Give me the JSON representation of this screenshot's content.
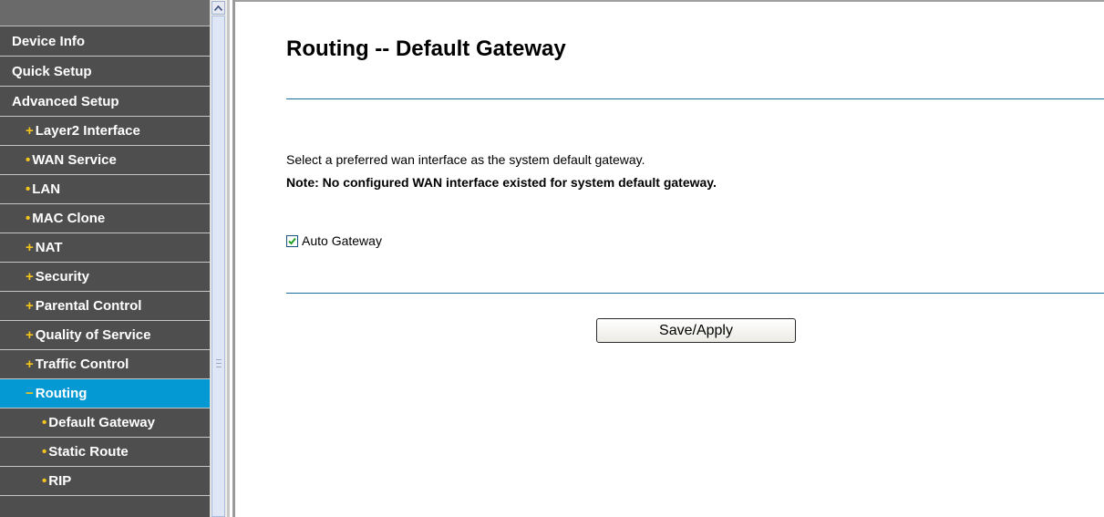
{
  "sidebar": {
    "items": [
      {
        "label": "Device Info",
        "bullet": ""
      },
      {
        "label": "Quick Setup",
        "bullet": ""
      },
      {
        "label": "Advanced Setup",
        "bullet": ""
      },
      {
        "label": "Layer2 Interface",
        "bullet": "+"
      },
      {
        "label": "WAN Service",
        "bullet": "•"
      },
      {
        "label": "LAN",
        "bullet": "•"
      },
      {
        "label": "MAC Clone",
        "bullet": "•"
      },
      {
        "label": "NAT",
        "bullet": "+"
      },
      {
        "label": "Security",
        "bullet": "+"
      },
      {
        "label": "Parental Control",
        "bullet": "+"
      },
      {
        "label": "Quality of Service",
        "bullet": "+"
      },
      {
        "label": "Traffic Control",
        "bullet": "+"
      },
      {
        "label": "Routing",
        "bullet": "−",
        "active": true
      },
      {
        "label": "Default Gateway",
        "bullet": "•"
      },
      {
        "label": "Static Route",
        "bullet": "•"
      },
      {
        "label": "RIP",
        "bullet": "•"
      }
    ]
  },
  "main": {
    "title": "Routing -- Default Gateway",
    "description": "Select a preferred wan interface as the system default gateway.",
    "note": "Note: No configured WAN interface existed for system default gateway.",
    "auto_gateway": {
      "label": "Auto Gateway",
      "checked": true
    },
    "save_button": "Save/Apply"
  },
  "colors": {
    "sidebar_bg": "#4e4e4e",
    "active_bg": "#0599d3",
    "bullet": "#f4c51c",
    "rule": "#1a6f9e"
  }
}
